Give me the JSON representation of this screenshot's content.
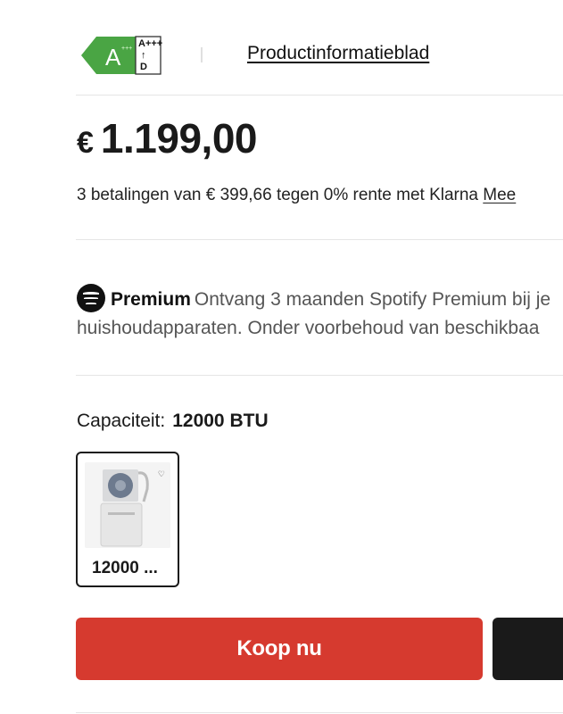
{
  "energy_label": {
    "class": "A",
    "scale_top": "A+++",
    "scale_arrow": "↑",
    "scale_bottom": "D",
    "color": "#4aa544"
  },
  "product_info_link": "Productinformatieblad",
  "price": {
    "currency": "€",
    "amount": "1.199,00"
  },
  "klarna": {
    "text": "3 betalingen van € 399,66 tegen 0% rente met Klarna",
    "link": "Mee"
  },
  "spotify": {
    "brand": "Premium",
    "line1": "Ontvang 3 maanden Spotify Premium bij je",
    "line2": "huishoudapparaten. Onder voorbehoud van beschikbaa"
  },
  "capacity": {
    "label": "Capaciteit:",
    "value": "12000 BTU"
  },
  "variants": [
    {
      "label": "12000 ...",
      "selected": true
    }
  ],
  "buttons": {
    "buy": "Koop nu"
  },
  "colors": {
    "buy": "#d63a2f",
    "dark": "#1a1a1a"
  }
}
